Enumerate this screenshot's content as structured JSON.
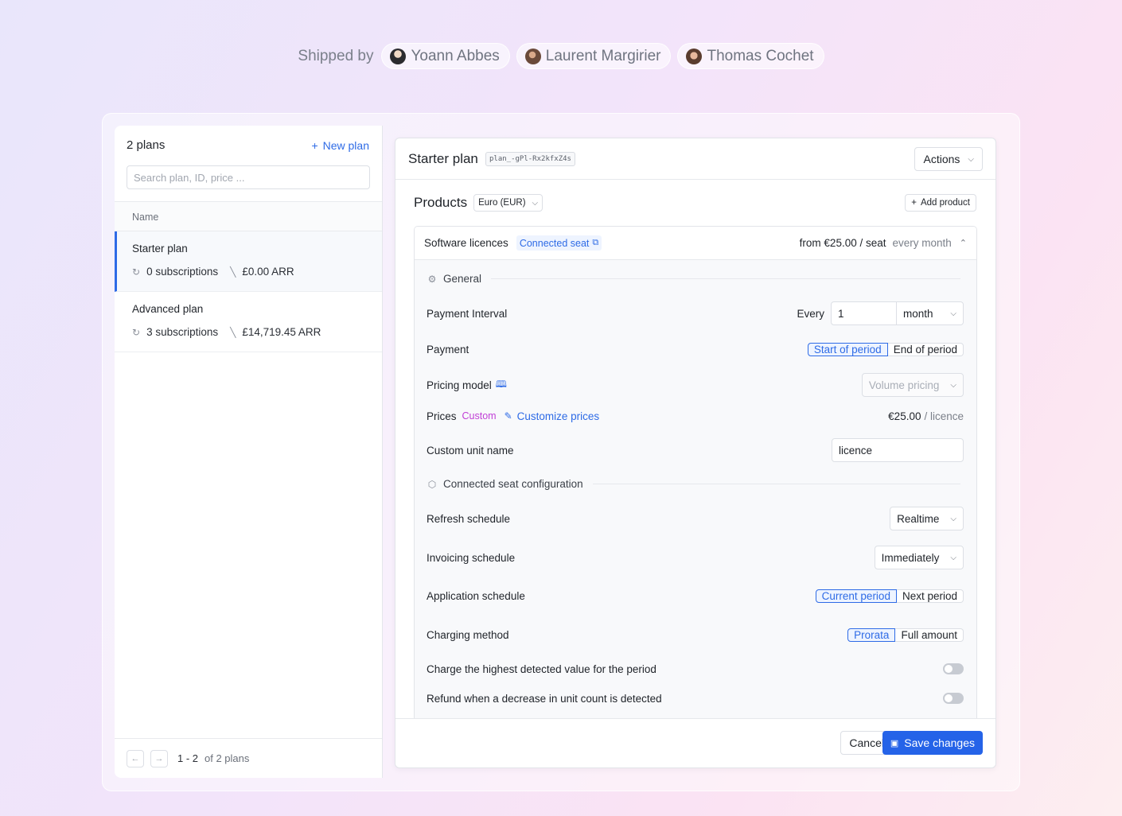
{
  "shipped": {
    "label": "Shipped by",
    "people": [
      "Yoann Abbes",
      "Laurent Margirier",
      "Thomas Cochet"
    ]
  },
  "sidebar": {
    "count_label": "2 plans",
    "new_plan_label": "New plan",
    "search_placeholder": "Search plan, ID, price ...",
    "column_header": "Name",
    "plans": [
      {
        "name": "Starter plan",
        "subscriptions": "0 subscriptions",
        "arr": "£0.00 ARR",
        "selected": true
      },
      {
        "name": "Advanced plan",
        "subscriptions": "3 subscriptions",
        "arr": "£14,719.45 ARR",
        "selected": false
      }
    ],
    "pagination": {
      "range": "1 - 2",
      "of_text": "of 2 plans"
    }
  },
  "detail": {
    "title": "Starter plan",
    "plan_id": "plan_-gPl-Rx2kfxZ4s",
    "actions_label": "Actions",
    "products_title": "Products",
    "currency": "Euro (EUR)",
    "add_product_label": "Add product",
    "product": {
      "name": "Software licences",
      "badge": "Connected seat",
      "price_text": "from €25.00 / seat",
      "period_text": "every month",
      "general_section": "General",
      "payment_interval_label": "Payment Interval",
      "every_label": "Every",
      "interval_value": "1",
      "interval_unit": "month",
      "payment_label": "Payment",
      "payment_options": [
        "Start of period",
        "End of period"
      ],
      "pricing_model_label": "Pricing model",
      "pricing_model_value": "Volume pricing",
      "prices_label": "Prices",
      "custom_badge": "Custom",
      "customize_prices_label": "Customize prices",
      "price_value": "€25.00",
      "price_unit": "/ licence",
      "custom_unit_label": "Custom unit name",
      "custom_unit_value": "licence",
      "connected_section": "Connected seat configuration",
      "refresh_label": "Refresh schedule",
      "refresh_value": "Realtime",
      "invoicing_label": "Invoicing schedule",
      "invoicing_value": "Immediately",
      "application_label": "Application schedule",
      "application_options": [
        "Current period",
        "Next period"
      ],
      "charging_label": "Charging method",
      "charging_options": [
        "Prorata",
        "Full amount"
      ],
      "highest_label": "Charge the highest detected value for the period",
      "highest_enabled": false,
      "refund_label": "Refund when a decrease in unit count is detected",
      "refund_enabled": false
    },
    "cancel_label": "Cancel",
    "save_label": "Save changes"
  },
  "colors": {
    "accent": "#2e6be6",
    "custom_badge": "#c03fd6"
  }
}
